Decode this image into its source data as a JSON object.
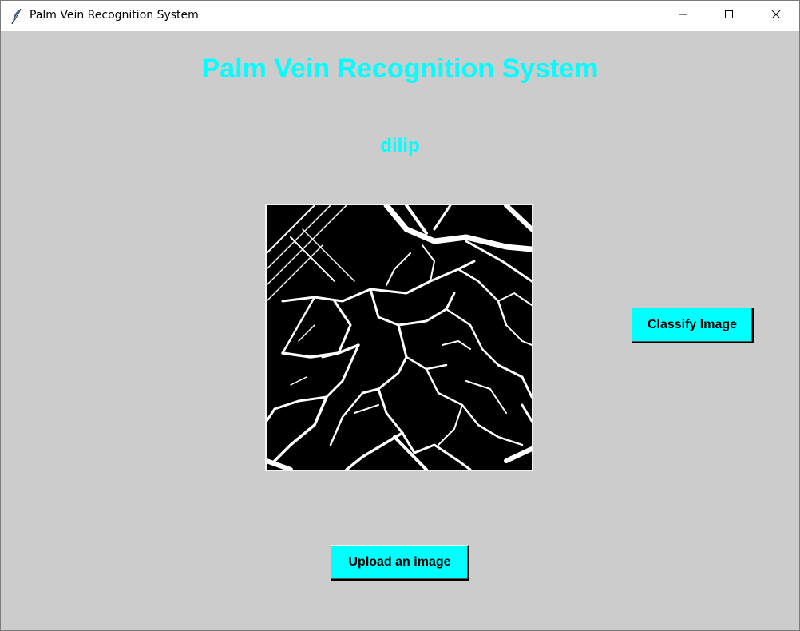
{
  "window": {
    "title": "Palm Vein Recognition System",
    "icon": "feather-icon",
    "controls": [
      "minimize-icon",
      "maximize-icon",
      "close-icon"
    ]
  },
  "main": {
    "heading": "Palm Vein Recognition System",
    "result_label": "dilip",
    "image_alt": "Palm vein binary image",
    "classify_button": "Classify Image",
    "upload_button": "Upload an image"
  },
  "colors": {
    "background": "#cccccc",
    "accent": "#00ffff",
    "button_text": "#000000"
  }
}
